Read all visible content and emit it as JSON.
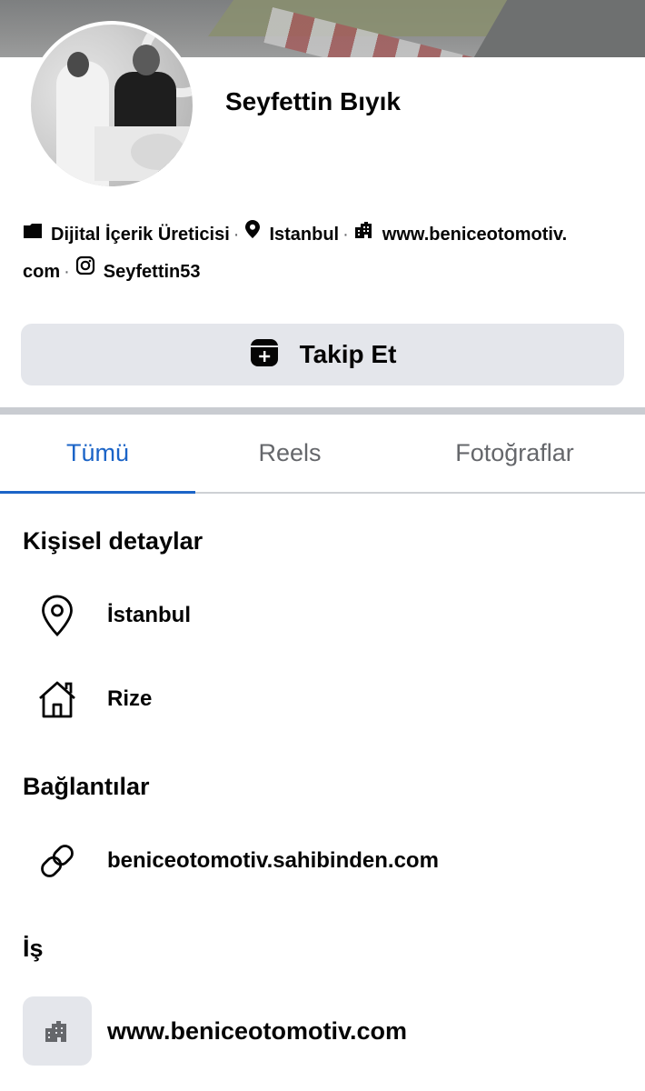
{
  "profile": {
    "name": "Seyfettin Bıyık"
  },
  "intro": {
    "category": "Dijital İçerik Üreticisi",
    "location": "Istanbul",
    "website_line1": "www.beniceotomotiv.",
    "website_line2": "com",
    "instagram": "Seyfettin53",
    "separator": "·"
  },
  "actions": {
    "follow_label": "Takip Et"
  },
  "tabs": [
    {
      "label": "Tümü",
      "active": true
    },
    {
      "label": "Reels",
      "active": false
    },
    {
      "label": "Fotoğraflar",
      "active": false
    }
  ],
  "sections": {
    "personal": {
      "title": "Kişisel detaylar",
      "items": [
        {
          "icon": "location-pin-icon",
          "text": "İstanbul"
        },
        {
          "icon": "house-icon",
          "text": "Rize"
        }
      ]
    },
    "links": {
      "title": "Bağlantılar",
      "items": [
        {
          "icon": "link-icon",
          "text": "beniceotomotiv.sahibinden.com"
        }
      ]
    },
    "work": {
      "title": "İş",
      "items": [
        {
          "icon": "building-icon",
          "text": "www.beniceotomotiv.com"
        }
      ]
    }
  },
  "colors": {
    "accent": "#1b64c7",
    "button_bg": "#e4e6eb",
    "muted_text": "#65676b",
    "divider": "#c9ccd1"
  }
}
